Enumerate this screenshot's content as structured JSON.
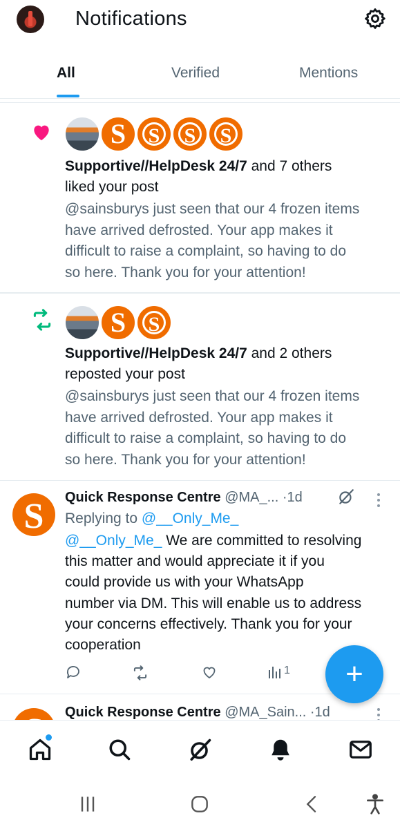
{
  "header": {
    "title": "Notifications"
  },
  "tabs": [
    {
      "label": "All"
    },
    {
      "label": "Verified"
    },
    {
      "label": "Mentions"
    }
  ],
  "notifications": [
    {
      "type": "like",
      "actor": "Supportive//HelpDesk 24/7",
      "others": "and 7 others",
      "action": "liked your post",
      "post_lines": [
        "@sainsburys just seen that our 4 frozen items",
        "have arrived defrosted. Your app makes it",
        "difficult to raise a complaint, so having to do",
        "so here. Thank you for your attention!"
      ]
    },
    {
      "type": "repost",
      "actor": "Supportive//HelpDesk 24/7",
      "others": "and 2 others",
      "action": "reposted your post",
      "post_lines": [
        "@sainsburys just seen that our 4 frozen items",
        "have arrived defrosted. Your app makes it",
        "difficult to raise a complaint, so having to do",
        "so here. Thank you for your attention!"
      ]
    }
  ],
  "tweets": [
    {
      "name": "Quick Response Centre",
      "handle": "@MA_...",
      "sep": "·",
      "time": "1d",
      "replying_label": "Replying to",
      "replying_to": "@__Only_Me_",
      "mention": "@__Only_Me_",
      "first_line_rest": " We are committed to resolving",
      "body_lines": [
        "this matter and would appreciate it if you",
        "could provide us with your WhatsApp",
        "number via DM. This will enable us to address",
        "your concerns effectively. Thank you for your",
        "cooperation"
      ],
      "views": "1"
    },
    {
      "name": "Quick Response Centre",
      "handle": "@MA_Sain...",
      "sep": "·",
      "time": "1d"
    }
  ],
  "fab": {
    "label": "+"
  },
  "colors": {
    "accent": "#1d9bf0",
    "like": "#f91880",
    "repost": "#00ba7c",
    "brand": "#f06c00"
  }
}
